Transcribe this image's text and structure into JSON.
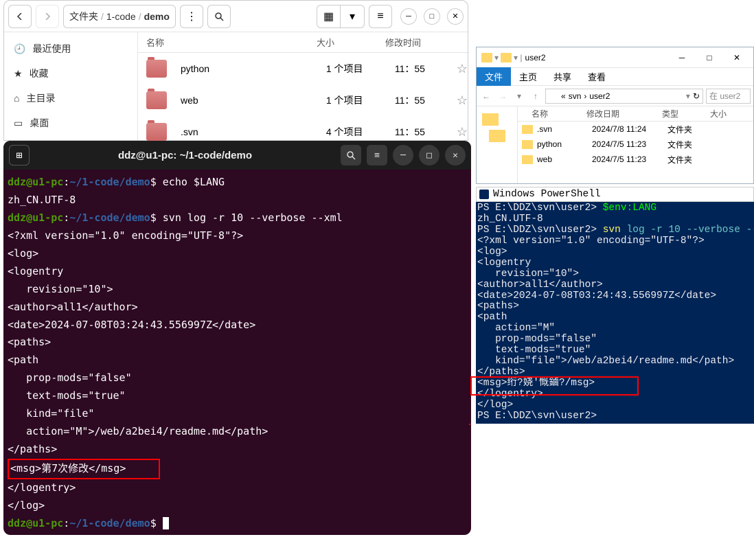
{
  "fm": {
    "breadcrumb": {
      "root": "文件夹",
      "p1": "1-code",
      "p2": "demo"
    },
    "sidebar": [
      {
        "label": "最近使用",
        "icon": "clock-icon"
      },
      {
        "label": "收藏",
        "icon": "star-icon"
      },
      {
        "label": "主目录",
        "icon": "home-icon"
      },
      {
        "label": "桌面",
        "icon": "desktop-icon"
      }
    ],
    "columns": {
      "name": "名称",
      "size": "大小",
      "date": "修改时间"
    },
    "rows": [
      {
        "name": "python",
        "size": "1 个项目",
        "date": "11：55"
      },
      {
        "name": "web",
        "size": "1 个项目",
        "date": "11：55"
      },
      {
        "name": ".svn",
        "size": "4 个项目",
        "date": "11：55"
      }
    ]
  },
  "term": {
    "title": "ddz@u1-pc: ~/1-code/demo",
    "user": "ddz@u1-pc",
    "path": "~/1-code/demo",
    "cmd1": "echo $LANG",
    "out1": "zh_CN.UTF-8",
    "cmd2": "svn log -r 10 --verbose --xml",
    "xml": [
      "<?xml version=\"1.0\" encoding=\"UTF-8\"?>",
      "<log>",
      "<logentry",
      "   revision=\"10\">",
      "<author>all1</author>",
      "<date>2024-07-08T03:24:43.556997Z</date>",
      "<paths>",
      "<path",
      "   prop-mods=\"false\"",
      "   text-mods=\"true\"",
      "   kind=\"file\"",
      "   action=\"M\">/web/a2bei4/readme.md</path>",
      "</paths>"
    ],
    "msg": "<msg>第7次修改</msg>",
    "xml2": [
      "</logentry>",
      "</log>"
    ]
  },
  "win": {
    "title": "user2",
    "tabs": {
      "file": "文件",
      "home": "主页",
      "share": "共享",
      "view": "查看"
    },
    "addr": {
      "prefix": "«",
      "p1": "svn",
      "p2": "user2"
    },
    "search": "在 user2",
    "columns": {
      "name": "名称",
      "date": "修改日期",
      "type": "类型",
      "size": "大小"
    },
    "rows": [
      {
        "name": ".svn",
        "date": "2024/7/8 11:24",
        "type": "文件夹"
      },
      {
        "name": "python",
        "date": "2024/7/5 11:23",
        "type": "文件夹"
      },
      {
        "name": "web",
        "date": "2024/7/5 11:23",
        "type": "文件夹"
      }
    ]
  },
  "ps": {
    "title": "Windows PowerShell",
    "prompt": "PS E:\\DDZ\\svn\\user2>",
    "cmd1": "$env:LANG",
    "out1": "zh_CN.UTF-8",
    "cmd2_parts": {
      "svn": "svn",
      "log": "log",
      "r": "-r",
      "ten": "10",
      "verbose": "--verbose",
      "xml": "--xml"
    },
    "xml": [
      "<?xml version=\"1.0\" encoding=\"UTF-8\"?>",
      "<log>",
      "<logentry",
      "   revision=\"10\">",
      "<author>all1</author>",
      "<date>2024-07-08T03:24:43.556997Z</date>",
      "<paths>",
      "<path",
      "   action=\"M\"",
      "   prop-mods=\"false\"",
      "   text-mods=\"true\"",
      "   kind=\"file\">/web/a2bei4/readme.md</path>",
      "</paths>"
    ],
    "msg": "<msg>绗?娆′慨鏀?/msg>",
    "xml2": [
      "</logentry>",
      "</log>"
    ]
  }
}
